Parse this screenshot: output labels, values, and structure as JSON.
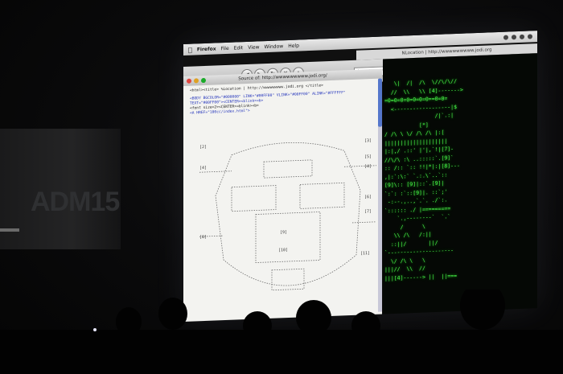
{
  "poster": {
    "text": "ADM15"
  },
  "menubar": {
    "app": "Firefox",
    "items": [
      "File",
      "Edit",
      "View",
      "Window",
      "Help"
    ]
  },
  "browser": {
    "title": "NLocation | http://wwwwwwwww.jodi.org",
    "url": "http://wwwwwwwww.jodi.org/"
  },
  "source_window": {
    "title": "Source of: http://wwwwwwwww.jodi.org/",
    "lines": [
      "<html><title> %Location | http://wwwwwwwww.jodi.org </title>",
      "<BODY BGCOLOR=\"#000000\" LINK=\"#00FF00\" VLINK=\"#00FF00\" ALINK=\"#FFFFFF\"",
      "TEXT=\"#00FF00\"><CENTER><blink><b>",
      "<font size=2><CENTER><blink><b>",
      "<A HREF=\"100cc/index.html\">"
    ]
  },
  "ascii_labels": [
    "[2]",
    "[3]",
    "[4]",
    "[5]",
    "[4]",
    "[6]",
    "[7]",
    "[8]",
    "[9]",
    "[10]",
    "[11]"
  ],
  "terminal": {
    "lines": [
      "   \\|  /|  /\\  \\//\\/\\//",
      "  //  \\\\   \\\\ [4]------->",
      "=0=0=0=0=0=0=0==0=0=",
      "  <------------------|$",
      "                /|`.:|",
      "           [*]",
      "/ /\\ \\ \\/ /\\ /\\ |:[",
      "||||||||||||||||||||",
      "|:|,/ .::' |'|,`!|[7]-",
      "//\\/\\ :\\ ..:::::`.[9]`",
      ":: /:: `:: !!|*|:|[8]---",
      ",|:`:\\:` `.:.\\`..`::",
      "[9]\\:: [9]|::`.[9]|",
      "`:`: :`::[9]|. ::`;'",
      " -:--.,..,`.`. ./`:.",
      "`:::::: ./ |=========",
      "    `.,--------`  `.`",
      "     /      \\",
      "   \\\\ /\\   /:||",
      "  ::||/       ||/",
      "`---------------------",
      "  \\/ /\\ \\   \\",
      "|||//  \\\\  //",
      "|||[4]------> ||  ||==="
    ]
  }
}
